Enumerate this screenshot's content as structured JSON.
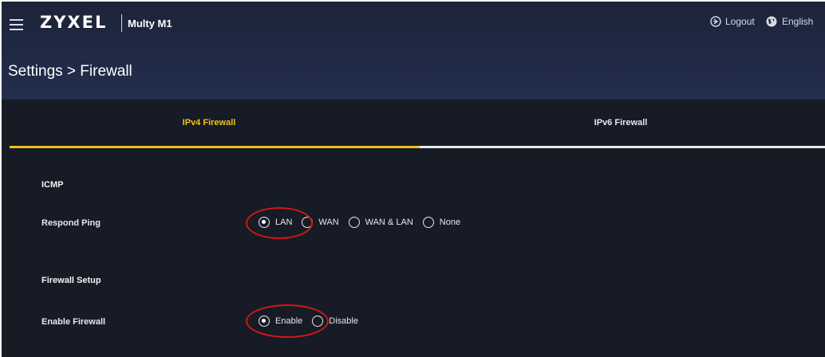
{
  "header": {
    "brand": "ZYXEL",
    "model": "Multy M1",
    "logout_label": "Logout",
    "language_label": "English",
    "menu_icon": "hamburger-menu-icon",
    "logout_icon": "logout-icon",
    "language_icon": "globe-icon"
  },
  "breadcrumb": "Settings > Firewall",
  "tabs": [
    {
      "label": "IPv4 Firewall",
      "active": true
    },
    {
      "label": "IPv6 Firewall",
      "active": false
    }
  ],
  "icmp": {
    "section_title": "ICMP",
    "respond_ping_label": "Respond Ping",
    "options": [
      "LAN",
      "WAN",
      "WAN & LAN",
      "None"
    ],
    "selected": "LAN"
  },
  "firewall_setup": {
    "section_title": "Firewall Setup",
    "enable_label": "Enable Firewall",
    "options": [
      "Enable",
      "Disable"
    ],
    "selected": "Enable"
  },
  "colors": {
    "accent": "#f2c21a",
    "background": "#161b25",
    "header": "#202a46",
    "annotation": "#d4151b"
  }
}
